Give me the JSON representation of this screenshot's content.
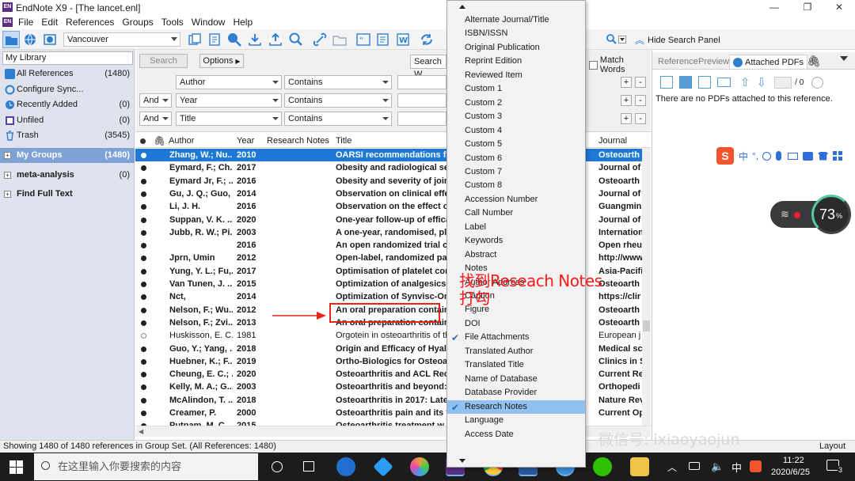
{
  "window": {
    "app_logo": "EN",
    "title": "EndNote X9 - [The lancet.enl]",
    "controls": [
      "—",
      "❐",
      "✕"
    ]
  },
  "menubar": {
    "logo": "EN",
    "items": [
      "File",
      "Edit",
      "References",
      "Groups",
      "Tools",
      "Window",
      "Help"
    ]
  },
  "toolbar": {
    "output_style": "Vancouver",
    "right_buttons": {
      "hide_search_panel": "Hide Search Panel"
    }
  },
  "library": {
    "selector": "My Library",
    "groups": [
      {
        "label": "All References",
        "count": "(1480)",
        "icon": "all-references-icon"
      },
      {
        "label": "Configure Sync...",
        "count": "",
        "icon": "sync-icon"
      },
      {
        "label": "Recently Added",
        "count": "(0)",
        "icon": "clock-icon"
      },
      {
        "label": "Unfiled",
        "count": "(0)",
        "icon": "unfiled-icon"
      },
      {
        "label": "Trash",
        "count": "(3545)",
        "icon": "trash-icon"
      }
    ],
    "group_sets": [
      {
        "label": "My Groups",
        "count": "(1480)",
        "selected": true
      },
      {
        "label": "meta-analysis",
        "count": "(0)",
        "selected": false
      },
      {
        "label": "Find Full Text",
        "count": "",
        "selected": false
      }
    ]
  },
  "search": {
    "search_button": "Search",
    "options_button": "Options",
    "scope_combo": "Search W",
    "match_words": "Match Words",
    "rows": [
      {
        "bool": "",
        "field": "Author",
        "op": "Contains"
      },
      {
        "bool": "And",
        "field": "Year",
        "op": "Contains"
      },
      {
        "bool": "And",
        "field": "Title",
        "op": "Contains"
      }
    ],
    "plus": "+",
    "minus": "-"
  },
  "reflist": {
    "columns": {
      "author": "Author",
      "year": "Year",
      "notes": "Research Notes",
      "title": "Title",
      "journal": "Journal"
    },
    "rows": [
      {
        "author": "Zhang, W.; Nu...",
        "year": "2010",
        "title": "OARSI recommendations for",
        "journal": "Osteoarth",
        "bold": true,
        "selected": true,
        "read": false
      },
      {
        "author": "Eymard, F.; Ch...",
        "year": "2017",
        "title": "Obesity and radiological seve",
        "journal": "Journal of",
        "bold": true,
        "selected": false,
        "read": false
      },
      {
        "author": "Eymard Jr, F.; ...",
        "year": "2016",
        "title": "Obesity and severity of joint",
        "journal": "Osteoarth",
        "bold": true,
        "selected": false,
        "read": false
      },
      {
        "author": "Gu, J. Q.; Guo, ...",
        "year": "2014",
        "title": "Observation on clinical effec",
        "journal": "Journal of",
        "bold": true,
        "selected": false,
        "read": false
      },
      {
        "author": "Li, J. H.",
        "year": "2016",
        "title": "Observation on the effect of",
        "journal": "Guangmin",
        "bold": true,
        "selected": false,
        "read": false
      },
      {
        "author": "Suppan, V. K. ...",
        "year": "2020",
        "title": "One-year follow-up of effica",
        "journal": "Journal of",
        "bold": true,
        "selected": false,
        "read": false
      },
      {
        "author": "Jubb, R. W.; Pi...",
        "year": "2003",
        "title": "A one-year, randomised, plac",
        "journal": "Internation",
        "bold": true,
        "selected": false,
        "read": false
      },
      {
        "author": "",
        "year": "2016",
        "title": "An open randomized trial co",
        "journal": "Open rheu",
        "bold": true,
        "selected": false,
        "read": false
      },
      {
        "author": "Jprn, Umin",
        "year": "2012",
        "title": "Open-label, randomized para",
        "journal": "http://www",
        "bold": true,
        "selected": false,
        "read": false
      },
      {
        "author": "Yung, Y. L.; Fu,...",
        "year": "2017",
        "title": "Optimisation of platelet conc",
        "journal": "Asia-Pacifi",
        "bold": true,
        "selected": false,
        "read": false
      },
      {
        "author": "Van Tunen, J. ...",
        "year": "2015",
        "title": "Optimization of analgesics al",
        "journal": "Osteoarth",
        "bold": true,
        "selected": false,
        "read": false
      },
      {
        "author": "Nct,",
        "year": "2014",
        "title": "Optimization of Synvisc-One",
        "journal": "https://clir",
        "bold": true,
        "selected": false,
        "read": false
      },
      {
        "author": "Nelson, F.; Wu...",
        "year": "2012",
        "title": "An oral preparation contain",
        "journal": "Osteoarth",
        "bold": true,
        "selected": false,
        "read": false
      },
      {
        "author": "Nelson, F.; Zvi...",
        "year": "2013",
        "title": "An oral preparation contain",
        "journal": "Osteoarth",
        "bold": true,
        "selected": false,
        "read": false
      },
      {
        "author": "Huskisson, E. C.;...",
        "year": "1981",
        "title": "Orgotein in osteoarthritis of th",
        "journal": "European j",
        "bold": false,
        "selected": false,
        "read": true
      },
      {
        "author": "Guo, Y.; Yang, ...",
        "year": "2018",
        "title": "Origin and Efficacy of Hyalur",
        "journal": "Medical sc",
        "bold": true,
        "selected": false,
        "read": false
      },
      {
        "author": "Huebner, K.; F...",
        "year": "2019",
        "title": "Ortho-Biologics for Osteoart",
        "journal": "Clinics in S",
        "bold": true,
        "selected": false,
        "read": false
      },
      {
        "author": "Cheung, E. C.; ...",
        "year": "2020",
        "title": "Osteoarthritis and ACL Recor",
        "journal": "Current Re",
        "bold": true,
        "selected": false,
        "read": false
      },
      {
        "author": "Kelly, M. A.; G...",
        "year": "2003",
        "title": "Osteoarthritis and beyond: a",
        "journal": "Orthopedi",
        "bold": true,
        "selected": false,
        "read": false
      },
      {
        "author": "McAlindon, T. ...",
        "year": "2018",
        "title": "Osteoarthritis in 2017: Latest",
        "journal": "Nature Rev",
        "bold": true,
        "selected": false,
        "read": false
      },
      {
        "author": "Creamer, P.",
        "year": "2000",
        "title": "Osteoarthritis pain and its tr",
        "journal": "Current Op",
        "bold": true,
        "selected": false,
        "read": false
      },
      {
        "author": "Putnam, M. C...",
        "year": "2015",
        "title": "Osteoarthritis treatment w...",
        "journal": "",
        "bold": true,
        "selected": false,
        "read": false
      }
    ]
  },
  "right_panel": {
    "tabs": [
      "Reference",
      "Preview",
      "Attached PDFs"
    ],
    "page_of": "/ 0",
    "message": "There are no PDFs attached to this reference."
  },
  "dropdown": {
    "items": [
      {
        "label": "Alternate Journal/Title",
        "checked": false,
        "highlighted": false
      },
      {
        "label": "ISBN/ISSN",
        "checked": false,
        "highlighted": false
      },
      {
        "label": "Original Publication",
        "checked": false,
        "highlighted": false
      },
      {
        "label": "Reprint Edition",
        "checked": false,
        "highlighted": false
      },
      {
        "label": "Reviewed Item",
        "checked": false,
        "highlighted": false
      },
      {
        "label": "Custom 1",
        "checked": false,
        "highlighted": false
      },
      {
        "label": "Custom 2",
        "checked": false,
        "highlighted": false
      },
      {
        "label": "Custom 3",
        "checked": false,
        "highlighted": false
      },
      {
        "label": "Custom 4",
        "checked": false,
        "highlighted": false
      },
      {
        "label": "Custom 5",
        "checked": false,
        "highlighted": false
      },
      {
        "label": "Custom 6",
        "checked": false,
        "highlighted": false
      },
      {
        "label": "Custom 7",
        "checked": false,
        "highlighted": false
      },
      {
        "label": "Custom 8",
        "checked": false,
        "highlighted": false
      },
      {
        "label": "Accession Number",
        "checked": false,
        "highlighted": false
      },
      {
        "label": "Call Number",
        "checked": false,
        "highlighted": false
      },
      {
        "label": "Label",
        "checked": false,
        "highlighted": false
      },
      {
        "label": "Keywords",
        "checked": false,
        "highlighted": false
      },
      {
        "label": "Abstract",
        "checked": false,
        "highlighted": false
      },
      {
        "label": "Notes",
        "checked": false,
        "highlighted": false
      },
      {
        "label": "Author Address",
        "checked": false,
        "highlighted": false
      },
      {
        "label": "Caption",
        "checked": false,
        "highlighted": false
      },
      {
        "label": "Figure",
        "checked": false,
        "highlighted": false
      },
      {
        "label": "DOI",
        "checked": false,
        "highlighted": false
      },
      {
        "label": "File Attachments",
        "checked": true,
        "highlighted": false
      },
      {
        "label": "Translated Author",
        "checked": false,
        "highlighted": false
      },
      {
        "label": "Translated Title",
        "checked": false,
        "highlighted": false
      },
      {
        "label": "Name of Database",
        "checked": false,
        "highlighted": false
      },
      {
        "label": "Database Provider",
        "checked": false,
        "highlighted": false
      },
      {
        "label": "Research Notes",
        "checked": true,
        "highlighted": true
      },
      {
        "label": "Language",
        "checked": false,
        "highlighted": false
      },
      {
        "label": "Access Date",
        "checked": false,
        "highlighted": false
      }
    ]
  },
  "annotation": {
    "line1": "找到Reseach Notes",
    "line2": "打勾",
    "color": "#ff1a1a"
  },
  "status": {
    "text": "Showing 1480 of 1480 references in Group Set. (All References: 1480)",
    "layout": "Layout"
  },
  "overlays": {
    "ime_logo": "S",
    "ime_labels": [
      "中",
      "°,"
    ],
    "network_percent": "73",
    "network_unit": "%",
    "watermark": "微信号: ixiaoyaojun"
  },
  "taskbar": {
    "search_placeholder": "在这里输入你要搜索的内容",
    "tray_lang": "中",
    "time": "11:22",
    "date": "2020/6/25",
    "notif_count": "3"
  }
}
